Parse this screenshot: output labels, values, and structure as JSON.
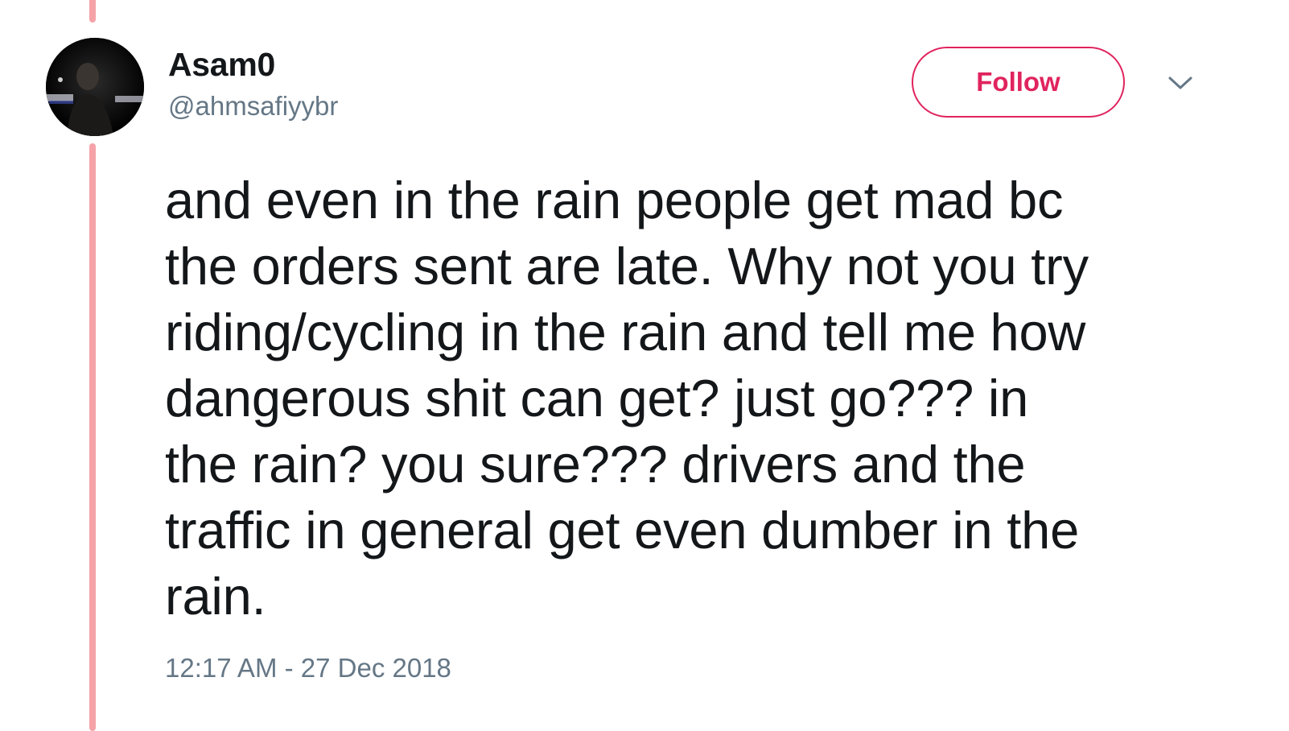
{
  "tweet": {
    "author": {
      "display_name": "Asam0",
      "handle": "@ahmsafiyybr"
    },
    "follow_label": "Follow",
    "text_lines": [
      "and even in the rain people get mad bc",
      "the orders sent are late. Why not you try",
      "riding/cycling in the rain and tell me how",
      "dangerous shit can get? just go??? in",
      "the rain? you sure??? drivers and the",
      "traffic in general get even dumber in the",
      "rain."
    ],
    "timestamp": "12:17 AM - 27 Dec 2018"
  },
  "colors": {
    "accent": "#e0245e",
    "thread_line": "#f5a3a8",
    "text_primary": "#14171a",
    "text_secondary": "#657786"
  },
  "icons": {
    "more_menu": "chevron-down-icon"
  }
}
